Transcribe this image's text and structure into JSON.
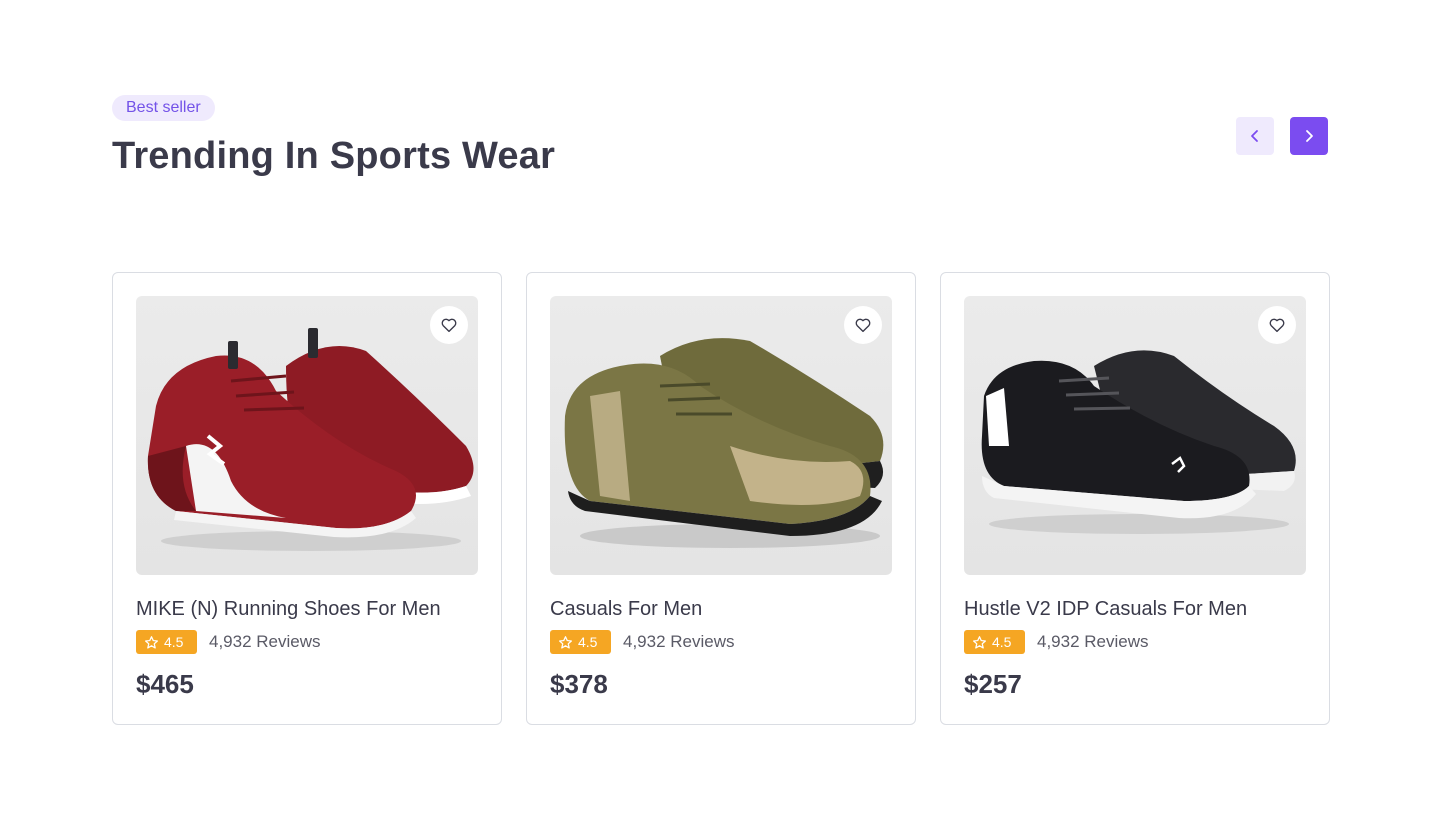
{
  "header": {
    "badge": "Best seller",
    "title": "Trending In Sports Wear"
  },
  "nav": {
    "prev_icon": "chevron-left-icon",
    "next_icon": "chevron-right-icon"
  },
  "colors": {
    "accent": "#7b4cf0",
    "accent_light": "#efeafd",
    "rating": "#f5a623"
  },
  "products": [
    {
      "name": "MIKE (N) Running Shoes For Men",
      "rating": "4.5",
      "reviews": "4,932 Reviews",
      "price": "$465",
      "shoe_color": "#8e1b24"
    },
    {
      "name": "Casuals For Men",
      "rating": "4.5",
      "reviews": "4,932 Reviews",
      "price": "$378",
      "shoe_color": "#6f6b3c"
    },
    {
      "name": "Hustle V2 IDP Casuals For Men",
      "rating": "4.5",
      "reviews": "4,932 Reviews",
      "price": "$257",
      "shoe_color": "#1b1b1f"
    }
  ]
}
